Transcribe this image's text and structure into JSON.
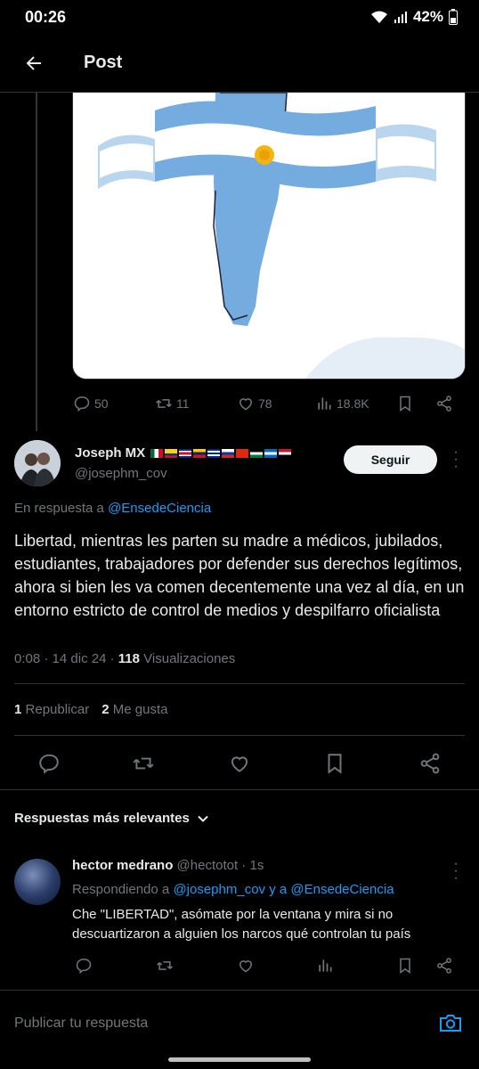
{
  "status_bar": {
    "time": "00:26",
    "battery": "42%"
  },
  "header": {
    "title": "Post"
  },
  "parent_post": {
    "actions": {
      "replies": "50",
      "reposts": "11",
      "likes": "78",
      "views": "18.8K"
    }
  },
  "post": {
    "author_name": "Joseph MX",
    "author_handle": "@josephm_cov",
    "follow_label": "Seguir",
    "reply_prefix": "En respuesta a",
    "reply_to": "@EnsedeCiencia",
    "text": "Libertad, mientras les parten su madre a médicos, jubilados, estudiantes, trabajadores por defender sus derechos legítimos, ahora si bien les va comen decentemente una vez al día, en un entorno estricto de control de medios y despilfarro oficialista",
    "time": "0:08",
    "date": "14 dic 24",
    "views_count": "118",
    "views_label": "Visualizaciones",
    "reposts_count": "1",
    "reposts_label": "Republicar",
    "likes_count": "2",
    "likes_label": "Me gusta"
  },
  "replies_section": {
    "sort_label": "Respuestas más relevantes"
  },
  "reply": {
    "name": "hector medrano",
    "handle": "@hectotot",
    "time": "1s",
    "replying_prefix": "Respondiendo a",
    "replying_user1": "@josephm_cov",
    "replying_and": "y a",
    "replying_user2": "@EnsedeCiencia",
    "text": "Che \"LIBERTAD\", asómate por la ventana y mira si no descuartizaron a alguien los narcos qué controlan tu país"
  },
  "composer": {
    "placeholder": "Publicar tu respuesta"
  },
  "colors": {
    "accent": "#1d9bf0",
    "background": "#000000",
    "muted": "#71767b",
    "text": "#e7e9ea"
  }
}
